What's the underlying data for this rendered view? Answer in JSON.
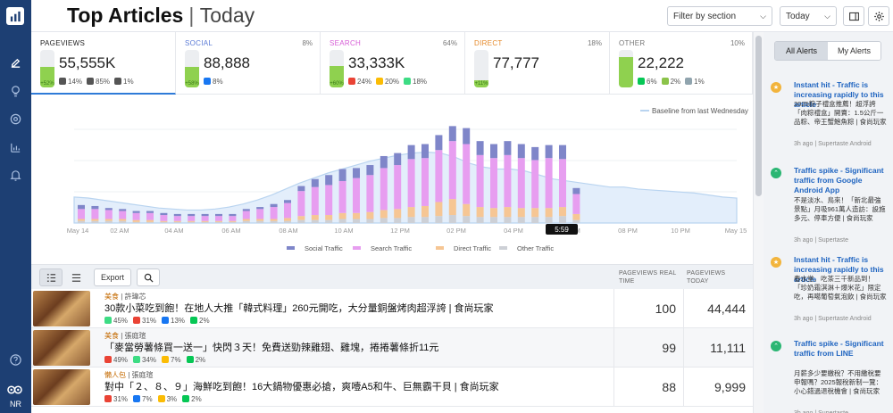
{
  "header": {
    "title": "Top Articles",
    "separator": "|",
    "subtitle": "Today",
    "filter_label": "Filter by section",
    "period_label": "Today"
  },
  "rail": {
    "user_initials": "NR"
  },
  "metrics": [
    {
      "label": "PAGEVIEWS",
      "pct": "",
      "value": "55,555K",
      "change": "+52%",
      "fill": 0.55,
      "color": "#222",
      "subs": [
        {
          "icon": "desktop-icon",
          "value": "14%"
        },
        {
          "icon": "mobile-icon",
          "value": "85%"
        },
        {
          "icon": "tablet-icon",
          "value": "1%"
        }
      ]
    },
    {
      "label": "SOCIAL",
      "pct": "8%",
      "value": "88,888",
      "change": "+58%",
      "fill": 0.55,
      "color": "#5b7bd6",
      "subs": [
        {
          "icon": "facebook-icon",
          "value": "8%"
        }
      ]
    },
    {
      "label": "SEARCH",
      "pct": "64%",
      "value": "33,333K",
      "change": "+60%",
      "fill": 0.58,
      "color": "#d65cd6",
      "subs": [
        {
          "icon": "google-icon",
          "value": "24%"
        },
        {
          "icon": "chrome-icon",
          "value": "20%"
        },
        {
          "icon": "android-icon",
          "value": "18%"
        }
      ]
    },
    {
      "label": "DIRECT",
      "pct": "18%",
      "value": "77,777",
      "change": "+11%",
      "fill": 0.2,
      "color": "#e58a2b",
      "subs": []
    },
    {
      "label": "OTHER",
      "pct": "10%",
      "value": "22,222",
      "change": "",
      "fill": 0.82,
      "color": "#777",
      "subs": [
        {
          "icon": "line-icon",
          "value": "6%"
        },
        {
          "icon": "image-icon",
          "value": "2%"
        },
        {
          "icon": "image2-icon",
          "value": "1%"
        }
      ]
    }
  ],
  "chart_data": {
    "type": "bar",
    "baseline_label": "Baseline from last Wednesday",
    "x_ticks": [
      "May 14",
      "02 AM",
      "04 AM",
      "06 AM",
      "08 AM",
      "10 AM",
      "12 PM",
      "02 PM",
      "04 PM",
      "06 PM",
      "08 PM",
      "10 PM",
      "May 15"
    ],
    "current_time_label": "5:59",
    "legend": [
      "Social Traffic",
      "Search Traffic",
      "Direct Traffic",
      "Other Traffic"
    ],
    "colors": {
      "social": "#7f86c9",
      "search": "#e79ef0",
      "direct": "#f6c694",
      "other": "#cdd0d6",
      "baseline": "#b9d4f0"
    },
    "series": [
      {
        "name": "Social Traffic",
        "values": [
          4,
          3,
          2,
          2,
          2,
          2,
          2,
          2,
          2,
          2,
          2,
          2,
          2,
          2,
          3,
          3,
          5,
          8,
          10,
          12,
          10,
          10,
          12,
          12,
          14,
          14,
          15,
          15,
          16,
          14,
          14,
          14,
          14,
          13,
          13,
          14,
          6
        ]
      },
      {
        "name": "Search Traffic",
        "values": [
          10,
          10,
          9,
          8,
          7,
          7,
          6,
          5,
          5,
          5,
          5,
          5,
          8,
          10,
          12,
          15,
          25,
          28,
          30,
          32,
          35,
          37,
          42,
          44,
          48,
          48,
          52,
          58,
          60,
          52,
          50,
          52,
          50,
          48,
          50,
          48,
          20
        ]
      },
      {
        "name": "Direct Traffic",
        "values": [
          2,
          2,
          2,
          2,
          2,
          2,
          1,
          1,
          1,
          1,
          1,
          1,
          2,
          2,
          2,
          3,
          4,
          5,
          5,
          6,
          6,
          7,
          8,
          9,
          10,
          11,
          14,
          16,
          12,
          10,
          9,
          10,
          9,
          9,
          9,
          9,
          6
        ]
      },
      {
        "name": "Other Traffic",
        "values": [
          2,
          2,
          2,
          2,
          1,
          1,
          1,
          1,
          1,
          1,
          1,
          1,
          2,
          2,
          2,
          2,
          3,
          3,
          3,
          4,
          4,
          4,
          5,
          5,
          6,
          6,
          7,
          8,
          7,
          6,
          6,
          6,
          6,
          6,
          6,
          7,
          3
        ]
      },
      {
        "name": "Baseline",
        "values": [
          26,
          25,
          23,
          21,
          19,
          17,
          15,
          14,
          13,
          13,
          14,
          16,
          19,
          23,
          28,
          34,
          40,
          45,
          50,
          54,
          58,
          62,
          65,
          68,
          70,
          71,
          70,
          66,
          60,
          56,
          54,
          54,
          52,
          48,
          44,
          42,
          40,
          38,
          36,
          36,
          34,
          33,
          32,
          31,
          30,
          28,
          26,
          25
        ]
      }
    ]
  },
  "table": {
    "export_label": "Export",
    "col_rt": [
      "PAGEVIEWS REAL",
      "TIME"
    ],
    "col_today": [
      "PAGEVIEWS",
      "TODAY"
    ],
    "rows": [
      {
        "category": "美食",
        "author": "許瑋芯",
        "headline": "30款小菜吃到飽！在地人大推「韓式料理」260元開吃，大分量銅盤烤肉超浮誇 | 食尚玩家",
        "sources": [
          {
            "icon": "android-icon",
            "value": "45%"
          },
          {
            "icon": "google-icon",
            "value": "31%"
          },
          {
            "icon": "facebook-icon",
            "value": "13%"
          },
          {
            "icon": "line-icon",
            "value": "2%"
          }
        ],
        "realtime": "100",
        "today": "44,444"
      },
      {
        "category": "美食",
        "author": "張庭瑄",
        "headline": "「麥當勞薯條買一送一」快閃３天！免費送勁辣雞翅、雞塊，捲捲薯條折11元",
        "sources": [
          {
            "icon": "google-icon",
            "value": "49%"
          },
          {
            "icon": "android-icon",
            "value": "34%"
          },
          {
            "icon": "chrome-icon",
            "value": "7%"
          },
          {
            "icon": "line-icon",
            "value": "2%"
          }
        ],
        "realtime": "99",
        "today": "11,111"
      },
      {
        "category": "懶人包",
        "author": "張庭瑄",
        "headline": "對中「２、８、９」海鮮吃到飽！16大鍋物優惠必搶，爽噎A5和牛、巨無霸干貝 | 食尚玩家",
        "sources": [
          {
            "icon": "google-icon",
            "value": "31%"
          },
          {
            "icon": "facebook-icon",
            "value": "7%"
          },
          {
            "icon": "chrome-icon",
            "value": "3%"
          },
          {
            "icon": "line-icon",
            "value": "2%"
          }
        ],
        "realtime": "88",
        "today": "9,999"
      }
    ]
  },
  "alerts": {
    "tab_all": "All Alerts",
    "tab_mine": "My Alerts",
    "items": [
      {
        "type": "instant",
        "title": "Instant hit - Traffic is increasing rapidly to this article",
        "desc": "2025粽子禮盒推薦！超浮誇「肉粽禮盒」開賣：1.5公斤一品粽、帝王蟹鮑魚粽 | 食尚玩家",
        "meta": "3h ago | Supertaste Android"
      },
      {
        "type": "spike",
        "title": "Traffic spike - Significant traffic from Google Android App",
        "desc": "不是淡水、鳥來！「新北最強景點」月吸961萬人造訪：設施多元、停車方便 | 食尚玩家",
        "meta": "3h ago | Supertaste"
      },
      {
        "type": "instant",
        "title": "Instant hit - Traffic is increasing rapidly to this article",
        "desc": "春水堂、吃茶三千新品到！「珍奶霜淇淋＋爆米花」限定吃，再噶葡萄氣泡飲 | 食尚玩家",
        "meta": "3h ago | Supertaste Android"
      },
      {
        "type": "spike",
        "title": "Traffic spike - Significant traffic from LINE",
        "desc": "月薪多少要繳稅？不用繳稅要申報嗎？2025報稅新制一覽：小心錯過退稅機會 | 食尚玩家",
        "meta": "3h ago | Supertaste"
      }
    ]
  }
}
